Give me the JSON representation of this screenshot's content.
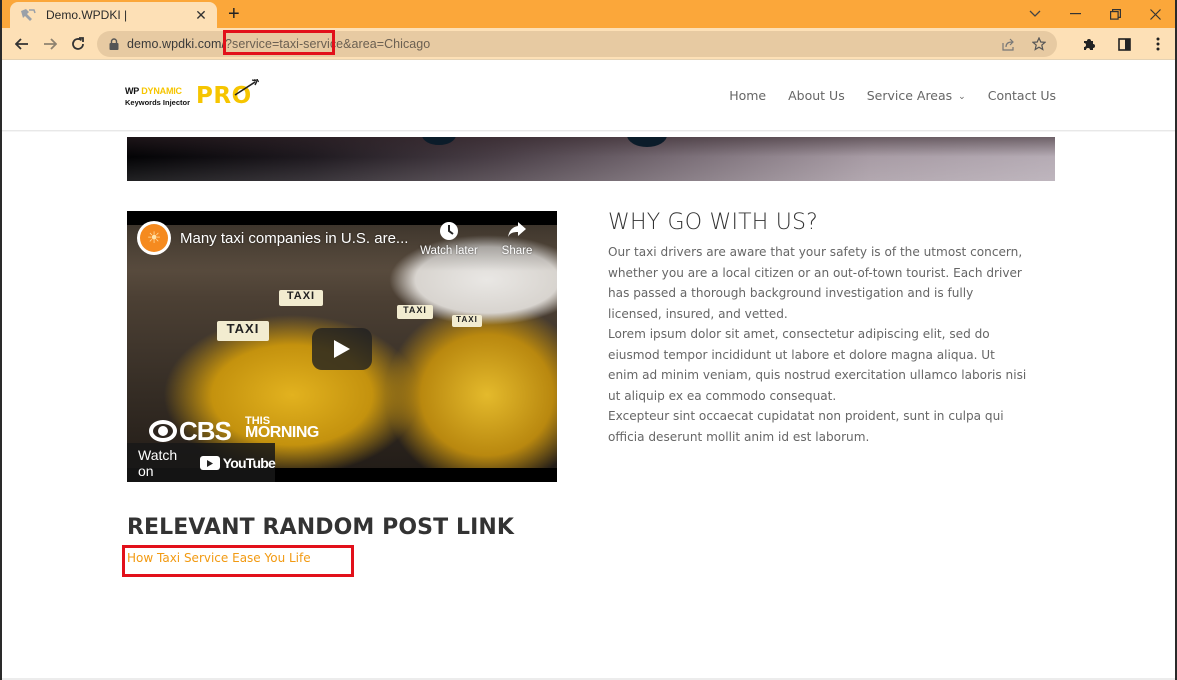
{
  "browser": {
    "tab": {
      "title": "Demo.WPDKI |",
      "favicon": "wrench-page-icon",
      "close_icon": "close-icon"
    },
    "new_tab_label": "+",
    "window_controls": {
      "tab_search": "chevron-down-icon",
      "minimize": "minimize-icon",
      "restore": "restore-icon",
      "close": "close-icon"
    },
    "toolbar": {
      "back": "back-arrow-icon",
      "forward": "forward-arrow-icon",
      "reload": "reload-icon",
      "url_host": "demo.wpdki.com/",
      "url_query_highlighted": "?service=taxi-service",
      "url_query_rest": "&area=Chicago",
      "omnibox_icons": [
        "share-icon",
        "star-icon"
      ],
      "right_icons": [
        "extensions-puzzle-icon",
        "side-panel-icon",
        "kebab-menu-icon"
      ]
    },
    "annotation_color": "#e2101a"
  },
  "site": {
    "logo": {
      "line1_a": "WP ",
      "line1_b": "DYNAMIC",
      "line2": "Keywords Injector",
      "pro": "PRO"
    },
    "nav": [
      {
        "label": "Home"
      },
      {
        "label": "About Us"
      },
      {
        "label": "Service Areas",
        "has_dropdown": true
      },
      {
        "label": "Contact Us"
      }
    ],
    "video": {
      "title": "Many taxi companies in U.S. are...",
      "watch_later": "Watch later",
      "share": "Share",
      "channel_logo_text": "CBS",
      "channel_sub_1": "THIS",
      "channel_sub_2": "MORNING",
      "taxi_sign": "TAXI",
      "watch_on": "Watch on",
      "youtube": "YouTube"
    },
    "why": {
      "title": "WHY GO WITH US?",
      "paragraphs": [
        "Our taxi drivers are aware that your safety is of the utmost concern, whether you are a local citizen or an out-of-town tourist. Each driver has passed a thorough background investigation and is fully licensed, insured, and vetted.",
        "Lorem ipsum dolor sit amet, consectetur adipiscing elit, sed do eiusmod tempor incididunt ut labore et dolore magna aliqua. Ut enim ad minim veniam, quis nostrud exercitation ullamco laboris nisi ut aliquip ex ea commodo consequat.",
        "Excepteur sint occaecat cupidatat non proident, sunt in culpa qui officia deserunt mollit anim id est laborum."
      ]
    },
    "related": {
      "title": "RELEVANT RANDOM POST LINK",
      "link": "How Taxi Service Ease You Life"
    },
    "colors": {
      "accent": "#f29a12",
      "logo_yellow": "#f6c500",
      "browser_frame": "#fba73a",
      "toolbar": "#fde0b6"
    }
  }
}
